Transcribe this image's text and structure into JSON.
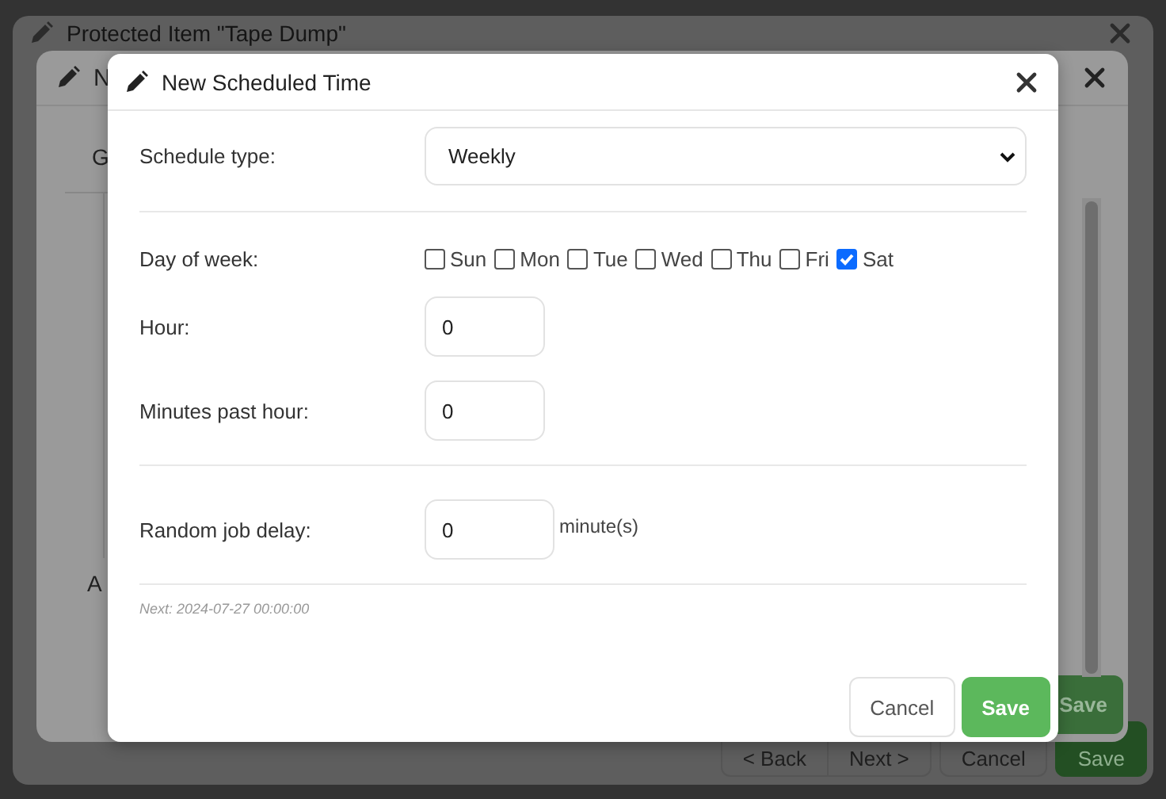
{
  "background_dialog": {
    "title": "Protected Item \"Tape Dump\"",
    "footer_buttons": [
      {
        "label": "< Back",
        "kind": "nav"
      },
      {
        "label": "Next >",
        "kind": "nav"
      },
      {
        "label": "Cancel",
        "kind": "default"
      },
      {
        "label": "Save",
        "kind": "primary"
      }
    ]
  },
  "middle_dialog": {
    "title": "N",
    "tab_label": "G",
    "field_label": "A",
    "footer_buttons": [
      {
        "label": "Save",
        "kind": "primary"
      }
    ]
  },
  "dialog": {
    "title": "New Scheduled Time",
    "schedule_type": {
      "label": "Schedule type:",
      "value": "Weekly"
    },
    "day_of_week": {
      "label": "Day of week:",
      "days": [
        {
          "label": "Sun",
          "checked": false
        },
        {
          "label": "Mon",
          "checked": false
        },
        {
          "label": "Tue",
          "checked": false
        },
        {
          "label": "Wed",
          "checked": false
        },
        {
          "label": "Thu",
          "checked": false
        },
        {
          "label": "Fri",
          "checked": false
        },
        {
          "label": "Sat",
          "checked": true
        }
      ]
    },
    "hour": {
      "label": "Hour:",
      "value": "0"
    },
    "minutes": {
      "label": "Minutes past hour:",
      "value": "0"
    },
    "random_delay": {
      "label": "Random job delay:",
      "value": "0",
      "unit": "minute(s)"
    },
    "next_run": "Next: 2024-07-27 00:00:00",
    "buttons": [
      {
        "label": "Cancel",
        "kind": "default"
      },
      {
        "label": "Save",
        "kind": "primary"
      }
    ]
  }
}
